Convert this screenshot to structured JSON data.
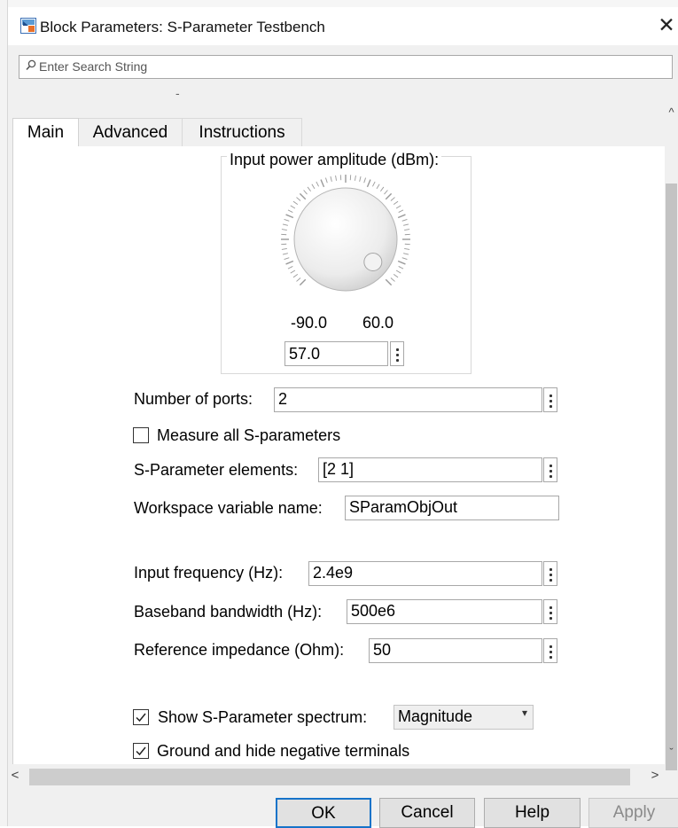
{
  "window": {
    "title": "Block Parameters: S-Parameter Testbench",
    "close_glyph": "✕"
  },
  "search": {
    "placeholder": "Enter Search String"
  },
  "tabs": [
    {
      "label": "Main",
      "selected": true
    },
    {
      "label": "Advanced",
      "selected": false
    },
    {
      "label": "Instructions",
      "selected": false
    }
  ],
  "knob": {
    "label": "Input power amplitude (dBm):",
    "min": "-90.0",
    "max": "60.0",
    "value": "57.0"
  },
  "params": {
    "num_ports": {
      "label": "Number of ports:",
      "value": "2"
    },
    "measure_all": {
      "label": "Measure all S-parameters",
      "checked": false
    },
    "sparam_elements": {
      "label": "S-Parameter elements:",
      "value": "[2 1]"
    },
    "workspace_var": {
      "label": "Workspace variable name:",
      "value": "SParamObjOut"
    },
    "input_freq": {
      "label": "Input frequency (Hz):",
      "value": "2.4e9"
    },
    "baseband_bw": {
      "label": "Baseband bandwidth (Hz):",
      "value": "500e6"
    },
    "ref_impedance": {
      "label": "Reference impedance (Ohm):",
      "value": "50"
    },
    "show_spectrum": {
      "label": "Show S-Parameter spectrum:",
      "checked": true,
      "option": "Magnitude"
    },
    "ground_hide": {
      "label": "Ground and hide negative terminals",
      "checked": true
    }
  },
  "scroll": {
    "up": "^",
    "down": "ˇ",
    "left": "<",
    "right": ">"
  },
  "buttons": {
    "ok": "OK",
    "cancel": "Cancel",
    "help": "Help",
    "apply": "Apply"
  },
  "colors": {
    "ok_border": "#1673c9",
    "dialog_bg": "#f0f0f0"
  }
}
